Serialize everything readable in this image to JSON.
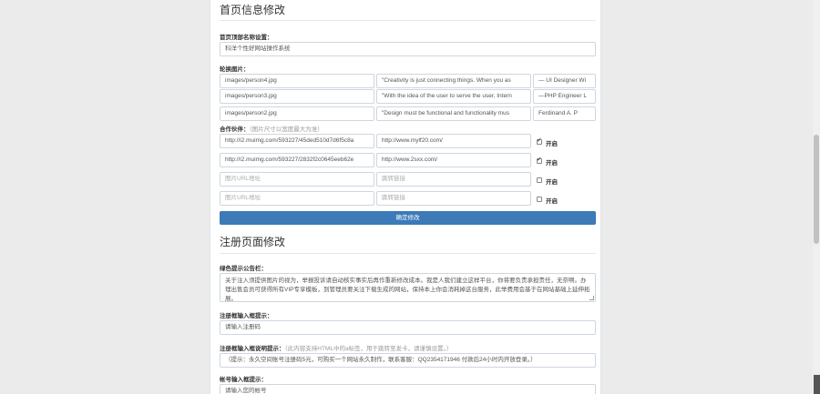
{
  "home": {
    "title": "首页信息修改",
    "site_name_label": "首页顶部名称设置：",
    "site_name_value": "科洋个性好网站操作系统",
    "slides_label": "轮换图片：",
    "slides": [
      {
        "image": "images/person4.jpg",
        "quote": "\"Creativity is just connecting things. When you as",
        "author": "— UI Designer Wi"
      },
      {
        "image": "images/person3.jpg",
        "quote": "\"With the idea of the user to serve the user, Intern",
        "author": "—PHP Engineer L"
      },
      {
        "image": "images/person2.jpg",
        "quote": "\"Design must be functional and functionality mus",
        "author": "Ferdinand A. P"
      }
    ],
    "partners_label": "合作伙伴：",
    "partners_hint": "（图片尺寸以宽度最大为准）",
    "partners": [
      {
        "image_url": "http://i2.muimg.com/593227/45ded510d7d6f5c8a",
        "link": "http://www.mylf20.com/",
        "enabled": true,
        "enabled_label": "开启"
      },
      {
        "image_url": "http://i2.muimg.com/593227/2832f2c0645eeb62e",
        "link": "http://www.2sxx.com/",
        "enabled": true,
        "enabled_label": "开启"
      },
      {
        "image_url": "",
        "link": "",
        "enabled": false,
        "enabled_label": "开启"
      },
      {
        "image_url": "",
        "link": "",
        "enabled": false,
        "enabled_label": "开启"
      }
    ],
    "image_placeholder": "图片URL地址",
    "link_placeholder": "跳转链接",
    "save_button": "确定修改"
  },
  "register": {
    "title": "注册页面修改",
    "notice_label": "绿色提示公告栏：",
    "notice_value": "关于注入须提供图片的视为，举报投诉请自动核实事实后再作重新修改成本。我是人我们建立这样平台，你将要负责承担责任，无奈啊。办理出售会员可获得所有VIP专享模板，到管理员要关注下载生成的网站，保持本上你会消耗掉这台服务，此举费用会基于在网站基础上延伸拓展。",
    "input_hint_label": "注册框输入框提示：",
    "input_hint_value": "请输入注册码",
    "tips_label": "注册框输入框说明提示：",
    "tips_hint": "（此内容支持HTML中的a标签，用于跳转至发卡，请谨慎设置。）",
    "tips_value": "（提示：永久空间账号注册码5元，可购买一个网站永久制作，联系客服：QQ2354171946  付款后24小时内开放登录。）",
    "account_label": "帐号输入框提示：",
    "account_value": "请输入您的帐号"
  }
}
